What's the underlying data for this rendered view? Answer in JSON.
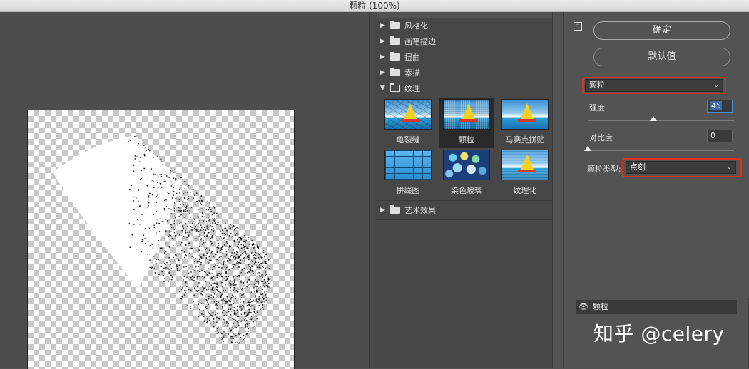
{
  "window": {
    "title": "颗粒 (100%)"
  },
  "gallery": {
    "folders_top": [
      {
        "label": "风格化"
      },
      {
        "label": "画笔描边"
      },
      {
        "label": "扭曲"
      },
      {
        "label": "素描"
      }
    ],
    "open_folder": {
      "label": "纹理"
    },
    "filters": [
      {
        "label": "龟裂缝"
      },
      {
        "label": "颗粒"
      },
      {
        "label": "马赛克拼贴"
      },
      {
        "label": "拼缀图"
      },
      {
        "label": "染色玻璃"
      },
      {
        "label": "纹理化"
      }
    ],
    "selected_filter": "颗粒",
    "folders_bottom": [
      {
        "label": "艺术效果"
      }
    ]
  },
  "panel": {
    "ok_label": "确定",
    "default_label": "默认值",
    "filter_select": "颗粒",
    "intensity": {
      "label": "强度",
      "value": "45",
      "slider_fraction": 0.45
    },
    "contrast": {
      "label": "对比度",
      "value": "0",
      "slider_fraction": 0.0
    },
    "grain_type": {
      "label": "颗粒类型:",
      "value": "点刻"
    },
    "layer_name": "颗粒"
  },
  "watermark": "知乎 @celery",
  "colors": {
    "highlight": "#e0301e",
    "background": "#535353",
    "focus": "#4a90d9"
  }
}
